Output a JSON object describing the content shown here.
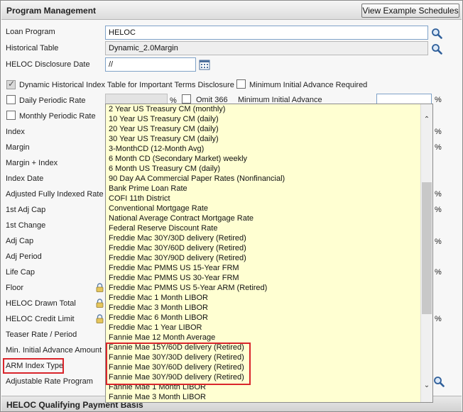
{
  "header": {
    "title": "Program Management",
    "view_button": "View Example Schedules"
  },
  "fields": {
    "loan_program": {
      "label": "Loan Program",
      "value": "HELOC"
    },
    "historical_table": {
      "label": "Historical Table",
      "value": "Dynamic_2.0Margin"
    },
    "disclosure_date": {
      "label": "HELOC Disclosure Date",
      "value": "//"
    },
    "dynamic_table": {
      "label": "Dynamic Historical Index Table for Important Terms Disclosure",
      "checked": true
    },
    "min_initial_required": {
      "label": "Minimum Initial Advance Required",
      "checked": false
    },
    "daily_periodic_rate": {
      "label": "Daily Periodic Rate",
      "value": ""
    },
    "omit_366": {
      "label": "Omit 366"
    },
    "min_initial_advance": {
      "label": "Minimum Initial Advance",
      "value": ""
    },
    "monthly_periodic_rate": {
      "label": "Monthly Periodic Rate"
    },
    "percent": "%"
  },
  "row_labels": [
    "Index",
    "Margin",
    "Margin + Index",
    "Index Date",
    "Adjusted Fully Indexed Rate",
    "1st Adj Cap",
    "1st Change",
    "Adj Cap",
    "Adj Period",
    "Life Cap",
    "Floor",
    "HELOC Drawn Total",
    "HELOC Credit Limit",
    "Teaser Rate / Period",
    "Min. Initial Advance Amount",
    "ARM Index Type",
    "Adjustable Rate Program"
  ],
  "dropdown_options": [
    "2 Year US Treasury CM (monthly)",
    "10 Year US Treasury CM (daily)",
    "20 Year US Treasury CM (daily)",
    "30 Year US Treasury CM (daily)",
    "3-MonthCD (12-Month Avg)",
    "6 Month CD (Secondary Market) weekly",
    "6 Month US Treasury CM (daily)",
    "90 Day AA Commercial Paper Rates (Nonfinancial)",
    "Bank Prime Loan Rate",
    "COFI 11th District",
    "Conventional Mortgage Rate",
    "National Average Contract Mortgage Rate",
    "Federal Reserve Discount Rate",
    "Freddie Mac 30Y/30D delivery (Retired)",
    "Freddie Mac 30Y/60D delivery (Retired)",
    "Freddie Mac 30Y/90D delivery (Retired)",
    "Freddie Mac PMMS US 15-Year FRM",
    "Freddie Mac PMMS US 30-Year FRM",
    "Freddie Mac PMMS US 5-Year ARM (Retired)",
    "Freddie Mac 1 Month LIBOR",
    "Freddie Mac 3 Month LIBOR",
    "Freddie Mac 6 Month LIBOR",
    "Freddie Mac 1 Year LIBOR",
    "Fannie Mae 12 Month Average",
    "Fannie Mae 15Y/60D delivery (Retired)",
    "Fannie Mae 30Y/30D delivery (Retired)",
    "Fannie Mae 30Y/60D delivery (Retired)",
    "Fannie Mae 30Y/90D delivery (Retired)",
    "Fannie Mae 1 Month LIBOR",
    "Fannie Mae 3 Month LIBOR"
  ],
  "footer": {
    "title": "HELOC Qualifying Payment Basis"
  },
  "colors": {
    "dropdown_bg": "#ffffd2",
    "highlight": "#d9252b",
    "input_border": "#7fa2c8"
  }
}
